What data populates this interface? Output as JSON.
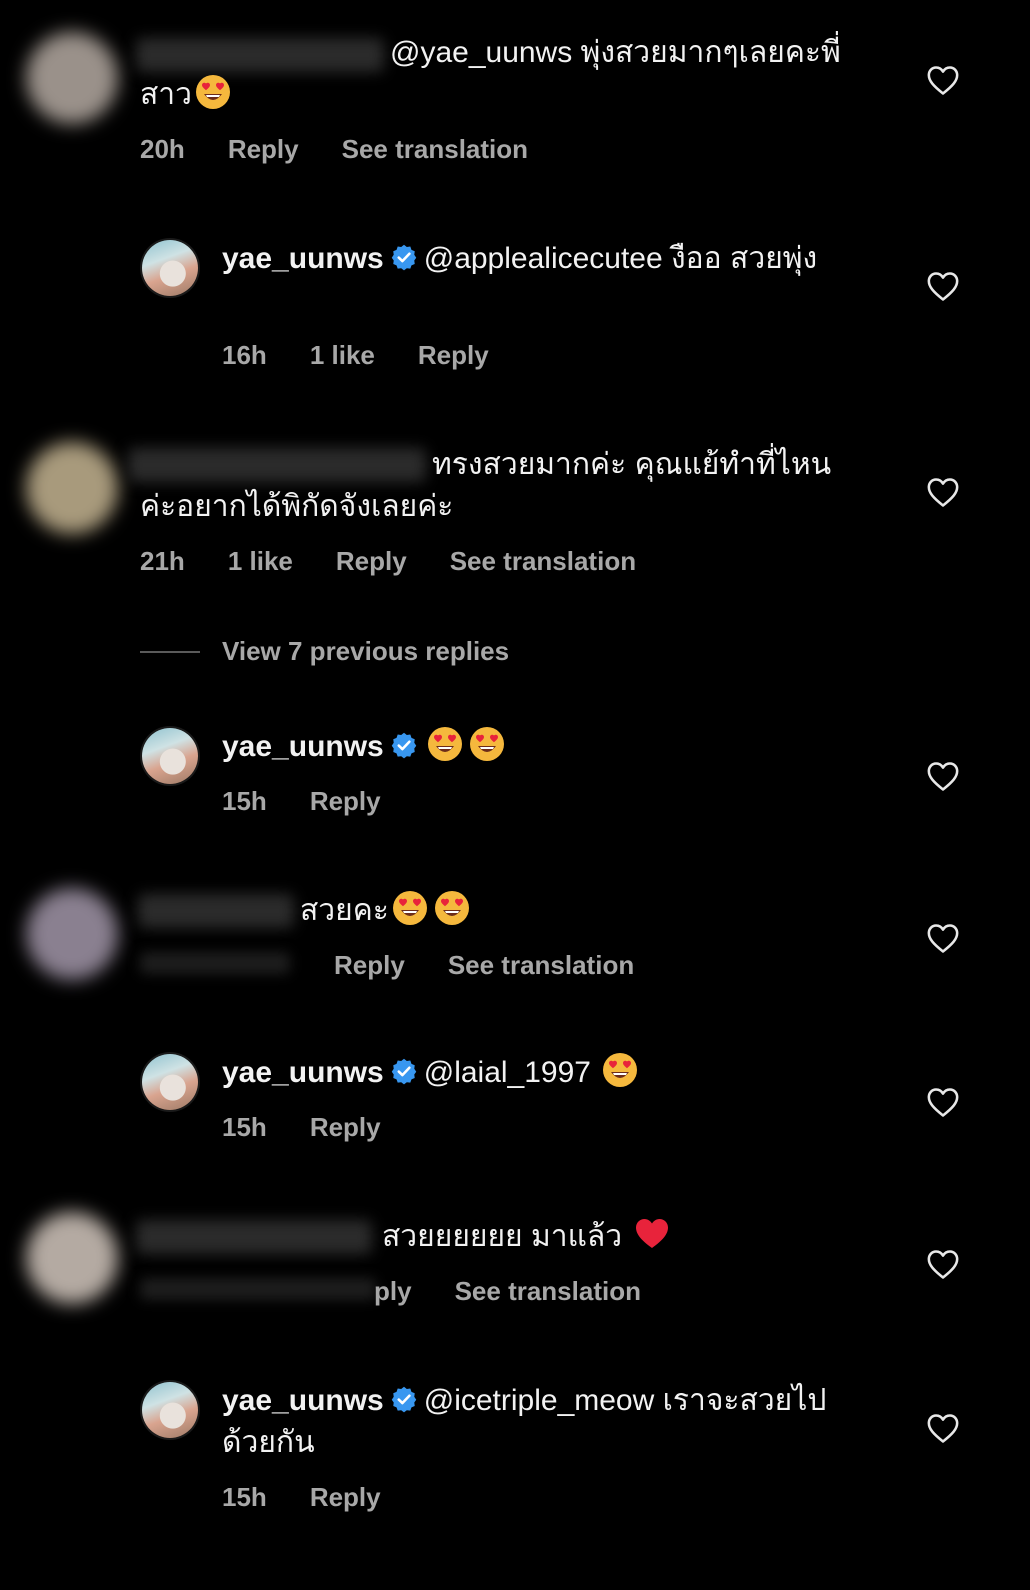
{
  "colors": {
    "background": "#000000",
    "text": "#f2f2f2",
    "meta": "#a8a8a8",
    "verified": "#3897f0"
  },
  "comments": [
    {
      "id": "c1",
      "text": "@yae_uunws พุ่งสวยมากๆเลยคะพี่สาว",
      "time": "20h",
      "reply": "Reply",
      "translate": "See translation"
    },
    {
      "id": "c2",
      "user": "yae_uunws",
      "text": "@applealicecutee งืออ สวยพุ่ง",
      "time": "16h",
      "likes": "1 like",
      "reply": "Reply"
    },
    {
      "id": "c3",
      "text": "ทรงสวยมากค่ะ คุณแย้ทำที่ไหนค่ะอยากได้พิกัดจังเลยค่ะ",
      "time": "21h",
      "likes": "1 like",
      "reply": "Reply",
      "translate": "See translation"
    },
    {
      "id": "c4",
      "user": "yae_uunws",
      "text": "",
      "time": "15h",
      "reply": "Reply"
    },
    {
      "id": "c5",
      "text": "สวยคะ",
      "reply": "Reply",
      "translate": "See translation"
    },
    {
      "id": "c6",
      "user": "yae_uunws",
      "text": "@laial_1997",
      "time": "15h",
      "reply": "Reply"
    },
    {
      "id": "c7",
      "text": "สวยยยยยย มาแล้ว",
      "reply": "ply",
      "translate": "See translation"
    },
    {
      "id": "c8",
      "user": "yae_uunws",
      "text": "@icetriple_meow เราจะสวยไปด้วยกัน",
      "time": "15h",
      "reply": "Reply"
    }
  ],
  "view_previous": "View 7 previous replies",
  "icons": [
    "heart-icon",
    "verified-icon",
    "heart-eyes-emoji",
    "red-heart-emoji"
  ]
}
